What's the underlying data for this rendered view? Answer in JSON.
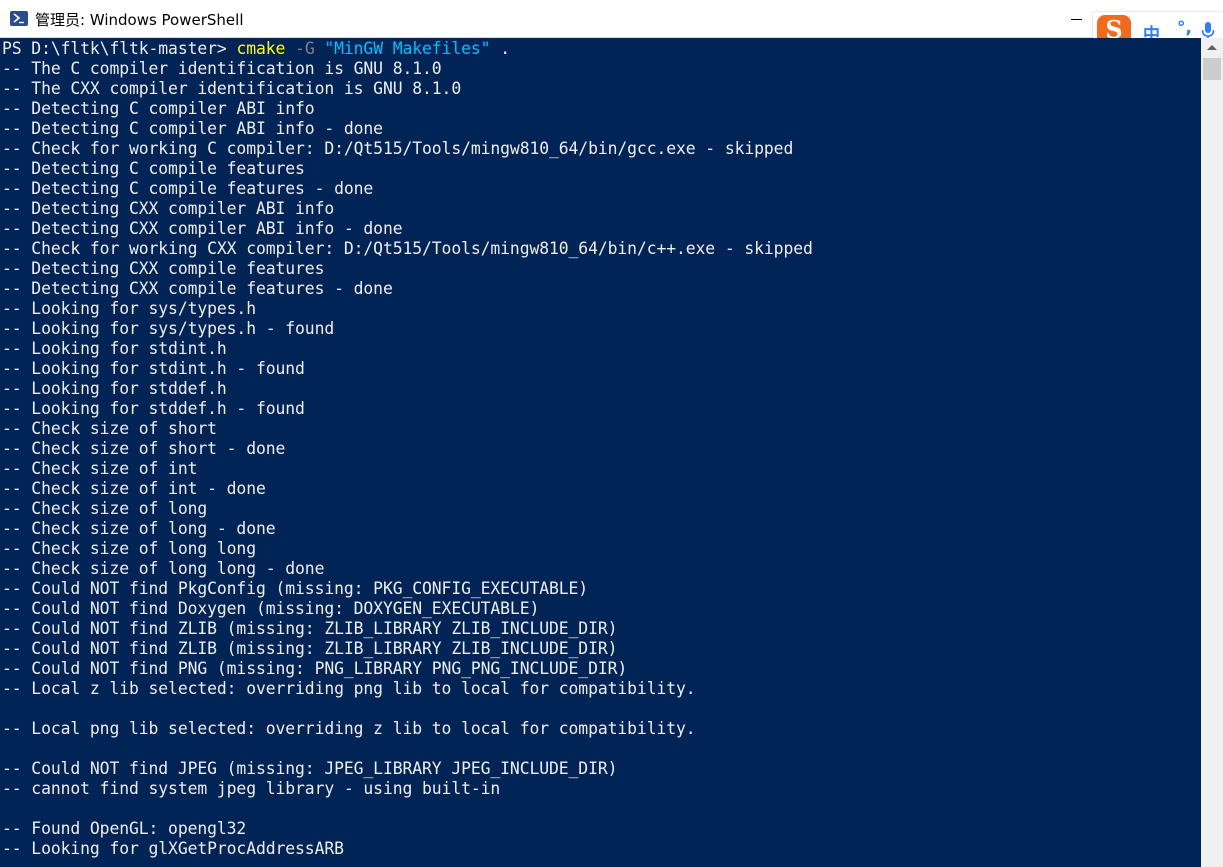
{
  "window": {
    "title": "管理员: Windows PowerShell",
    "icon": "powershell-icon"
  },
  "ime": {
    "logo": "S",
    "mode": "中",
    "punct": "°,",
    "icon": "microphone-icon"
  },
  "prompt": {
    "ps": "PS D:\\fltk\\fltk-master> ",
    "cmd": "cmake",
    "param": " -G ",
    "arg": "\"MinGW Makefiles\"",
    "rest": " ."
  },
  "output": [
    "-- The C compiler identification is GNU 8.1.0",
    "-- The CXX compiler identification is GNU 8.1.0",
    "-- Detecting C compiler ABI info",
    "-- Detecting C compiler ABI info - done",
    "-- Check for working C compiler: D:/Qt515/Tools/mingw810_64/bin/gcc.exe - skipped",
    "-- Detecting C compile features",
    "-- Detecting C compile features - done",
    "-- Detecting CXX compiler ABI info",
    "-- Detecting CXX compiler ABI info - done",
    "-- Check for working CXX compiler: D:/Qt515/Tools/mingw810_64/bin/c++.exe - skipped",
    "-- Detecting CXX compile features",
    "-- Detecting CXX compile features - done",
    "-- Looking for sys/types.h",
    "-- Looking for sys/types.h - found",
    "-- Looking for stdint.h",
    "-- Looking for stdint.h - found",
    "-- Looking for stddef.h",
    "-- Looking for stddef.h - found",
    "-- Check size of short",
    "-- Check size of short - done",
    "-- Check size of int",
    "-- Check size of int - done",
    "-- Check size of long",
    "-- Check size of long - done",
    "-- Check size of long long",
    "-- Check size of long long - done",
    "-- Could NOT find PkgConfig (missing: PKG_CONFIG_EXECUTABLE)",
    "-- Could NOT find Doxygen (missing: DOXYGEN_EXECUTABLE)",
    "-- Could NOT find ZLIB (missing: ZLIB_LIBRARY ZLIB_INCLUDE_DIR)",
    "-- Could NOT find ZLIB (missing: ZLIB_LIBRARY ZLIB_INCLUDE_DIR)",
    "-- Could NOT find PNG (missing: PNG_LIBRARY PNG_PNG_INCLUDE_DIR)",
    "-- Local z lib selected: overriding png lib to local for compatibility.",
    "",
    "-- Local png lib selected: overriding z lib to local for compatibility.",
    "",
    "-- Could NOT find JPEG (missing: JPEG_LIBRARY JPEG_INCLUDE_DIR)",
    "-- cannot find system jpeg library - using built-in",
    "",
    "-- Found OpenGL: opengl32",
    "-- Looking for glXGetProcAddressARB"
  ],
  "colors": {
    "console_bg": "#012456",
    "console_text": "#eeedf0",
    "cmd_name": "#ffff00",
    "cmd_param": "#808080",
    "cmd_string": "#00bfff"
  }
}
